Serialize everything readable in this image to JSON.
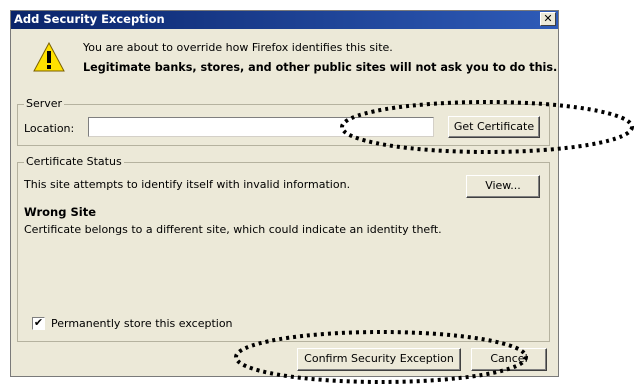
{
  "window": {
    "title": "Add Security Exception",
    "close_label": "✕"
  },
  "intro": {
    "line1": "You are about to override how Firefox identifies this site.",
    "line2": "Legitimate banks, stores, and other public sites will not ask you to do this."
  },
  "server": {
    "group_label": "Server",
    "location_label": "Location:",
    "location_value": "",
    "get_certificate_label": "Get Certificate"
  },
  "certificate_status": {
    "group_label": "Certificate Status",
    "message": "This site attempts to identify itself with invalid information.",
    "view_label": "View...",
    "issue_title": "Wrong Site",
    "issue_detail": "Certificate belongs to a different site, which could indicate an identity theft."
  },
  "permanent": {
    "label": "Permanently store this exception",
    "checked": true,
    "check_glyph": "✔"
  },
  "footer": {
    "confirm_label": "Confirm Security Exception",
    "cancel_label": "Cancel"
  },
  "icons": {
    "warning": "warning-triangle-icon"
  }
}
